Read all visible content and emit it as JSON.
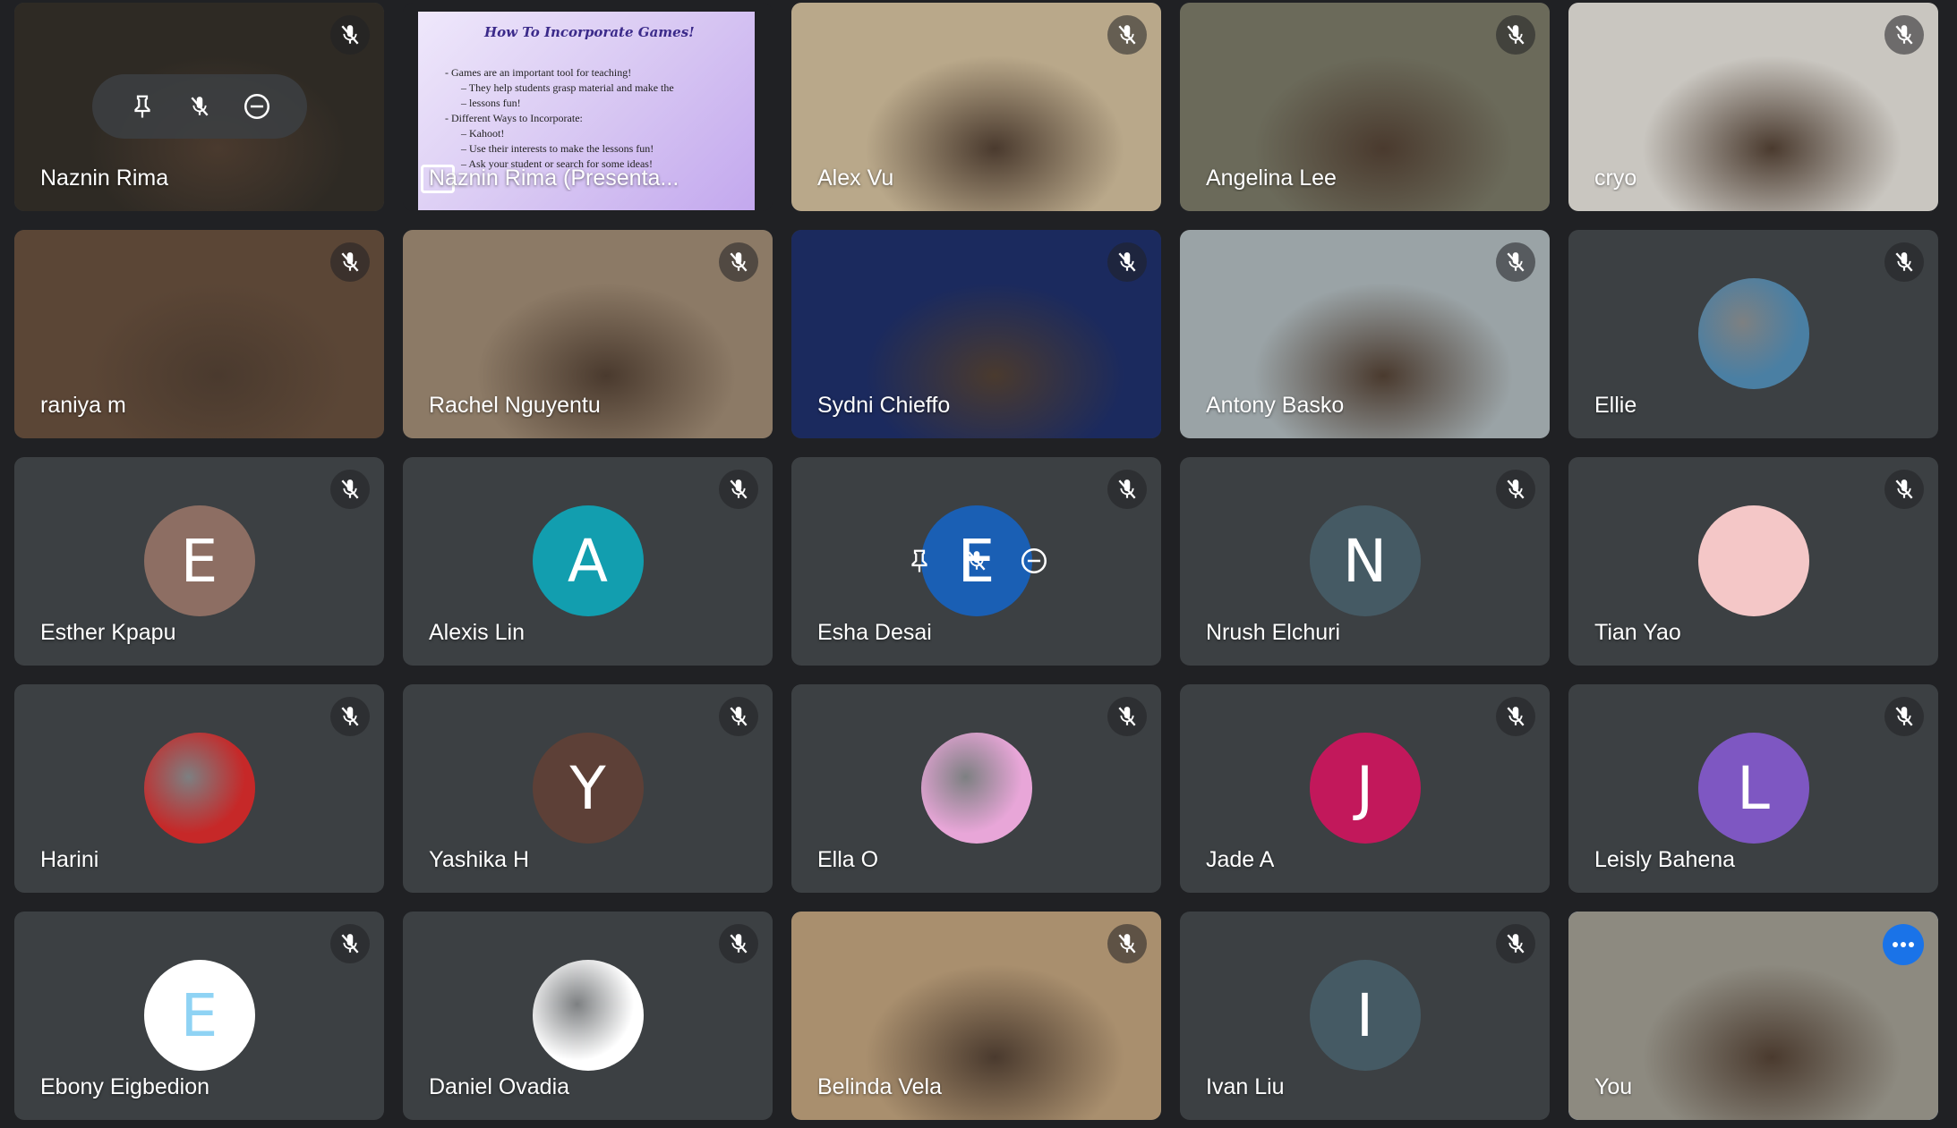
{
  "participants": [
    {
      "name": "Naznin Rima",
      "kind": "video",
      "bg": "#2e2a24",
      "hover": true
    },
    {
      "name": "Naznin Rima (Presenta...",
      "kind": "presentation"
    },
    {
      "name": "Alex Vu",
      "kind": "video",
      "bg": "#b9a88a"
    },
    {
      "name": "Angelina Lee",
      "kind": "video",
      "bg": "#6b6a5a"
    },
    {
      "name": "cryo",
      "kind": "video",
      "bg": "#c9c6c0"
    },
    {
      "name": "raniya m",
      "kind": "video",
      "bg": "#5b4636"
    },
    {
      "name": "Rachel Nguyentu",
      "kind": "video",
      "bg": "#8c7a66"
    },
    {
      "name": "Sydni Chieffo",
      "kind": "video",
      "bg": "#1b2a5e"
    },
    {
      "name": "Antony Basko",
      "kind": "video",
      "bg": "#9aa3a6"
    },
    {
      "name": "Ellie",
      "kind": "image-avatar",
      "avatar_color": "#4a7fa3"
    },
    {
      "name": "Esther Kpapu",
      "kind": "letter",
      "letter": "E",
      "avatar_color": "#8d6e63"
    },
    {
      "name": "Alexis Lin",
      "kind": "letter",
      "letter": "A",
      "avatar_color": "#129eaf"
    },
    {
      "name": "Esha Desai",
      "kind": "letter",
      "letter": "E",
      "avatar_color": "#1a5fb4",
      "hover": true
    },
    {
      "name": "Nrush Elchuri",
      "kind": "letter",
      "letter": "N",
      "avatar_color": "#455a64"
    },
    {
      "name": "Tian Yao",
      "kind": "letter",
      "letter": "",
      "avatar_color": "#f4c7c7"
    },
    {
      "name": "Harini",
      "kind": "image-avatar",
      "avatar_color": "#c62828"
    },
    {
      "name": "Yashika H",
      "kind": "letter",
      "letter": "Y",
      "avatar_color": "#5d4037"
    },
    {
      "name": "Ella O",
      "kind": "image-avatar",
      "avatar_color": "#e8a6d8"
    },
    {
      "name": "Jade A",
      "kind": "letter",
      "letter": "J",
      "avatar_color": "#c2185b"
    },
    {
      "name": "Leisly Bahena",
      "kind": "letter",
      "letter": "L",
      "avatar_color": "#7e57c2"
    },
    {
      "name": "Ebony Eigbedion",
      "kind": "letter",
      "letter": "E",
      "avatar_color": "#ffffff",
      "letter_color": "#8fd3f4"
    },
    {
      "name": "Daniel Ovadia",
      "kind": "image-avatar",
      "avatar_color": "#ffffff"
    },
    {
      "name": "Belinda Vela",
      "kind": "video",
      "bg": "#a98f6e"
    },
    {
      "name": "Ivan Liu",
      "kind": "letter",
      "letter": "I",
      "avatar_color": "#455a64"
    },
    {
      "name": "You",
      "kind": "self",
      "bg": "#8d8a80"
    }
  ],
  "slide": {
    "title": "How To Incorporate Games!",
    "bullets": [
      {
        "text": "Games are an important tool for teaching!",
        "sub": false
      },
      {
        "text": "They help students grasp material and make the",
        "sub": true
      },
      {
        "text": "lessons fun!",
        "sub": true
      },
      {
        "text": "Different Ways to Incorporate:",
        "sub": false
      },
      {
        "text": "Kahoot!",
        "sub": true
      },
      {
        "text": "Use their interests to make the lessons fun!",
        "sub": true
      },
      {
        "text": "Ask your student or search for some ideas!",
        "sub": true
      }
    ]
  }
}
